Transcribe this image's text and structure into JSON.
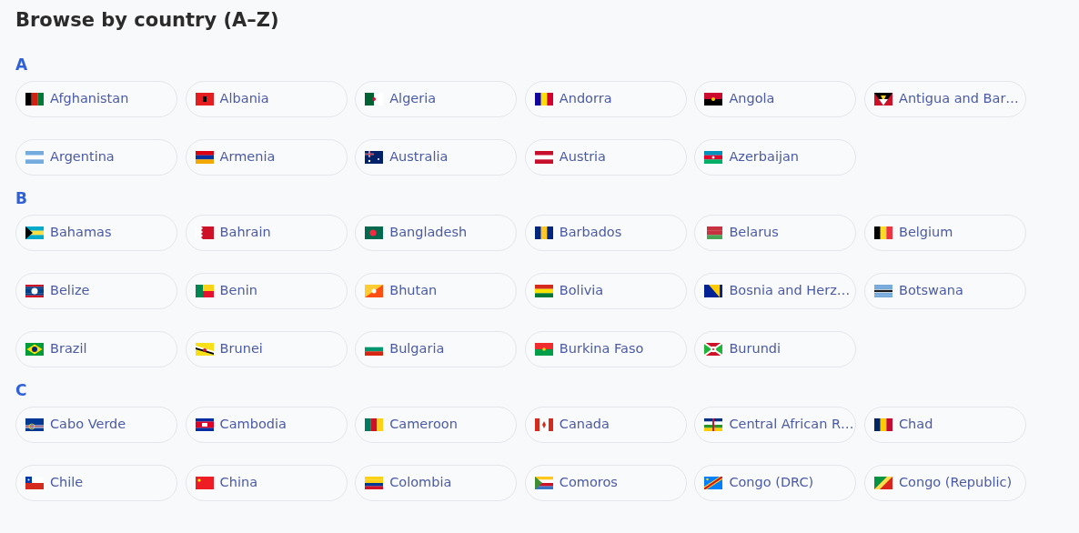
{
  "title": "Browse by country (A–Z)",
  "sections": [
    {
      "letter": "A",
      "countries": [
        "Afghanistan",
        "Albania",
        "Algeria",
        "Andorra",
        "Angola",
        "Antigua and Bar…",
        "Argentina",
        "Armenia",
        "Australia",
        "Austria",
        "Azerbaijan"
      ]
    },
    {
      "letter": "B",
      "countries": [
        "Bahamas",
        "Bahrain",
        "Bangladesh",
        "Barbados",
        "Belarus",
        "Belgium",
        "Belize",
        "Benin",
        "Bhutan",
        "Bolivia",
        "Bosnia and Herz…",
        "Botswana",
        "Brazil",
        "Brunei",
        "Bulgaria",
        "Burkina Faso",
        "Burundi"
      ]
    },
    {
      "letter": "C",
      "countries": [
        "Cabo Verde",
        "Cambodia",
        "Cameroon",
        "Canada",
        "Central African R…",
        "Chad",
        "Chile",
        "China",
        "Colombia",
        "Comoros",
        "Congo (DRC)",
        "Congo (Republic)"
      ]
    }
  ]
}
